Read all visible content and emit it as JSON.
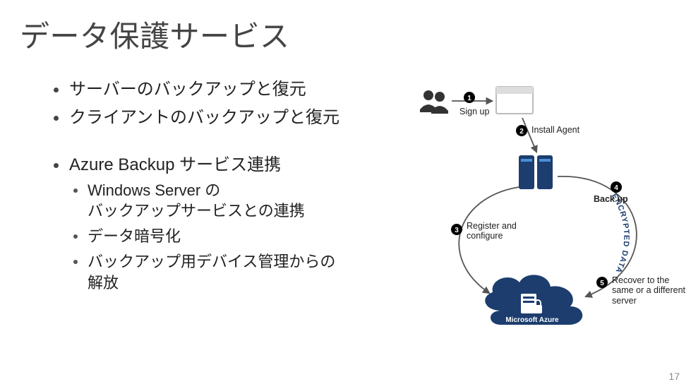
{
  "title": "データ保護サービス",
  "bullets": {
    "b1": "サーバーのバックアップと復元",
    "b2": "クライアントのバックアップと復元",
    "b3": "Azure Backup サービス連携",
    "b3s1": "Windows Server の\nバックアップサービスとの連携",
    "b3s2": "データ暗号化",
    "b3s3": "バックアップ用デバイス管理からの\n解放"
  },
  "diagram": {
    "step1": "Sign up",
    "step2": "Install Agent",
    "step3": "Register and\nconfigure",
    "step4": "Back up",
    "step5": "Recover to the\nsame or a different\nserver",
    "arc_text": "ENCRYPTED DATA",
    "cloud_label": "Microsoft Azure"
  },
  "colors": {
    "brand_navy": "#1c3d6e",
    "accent_blue": "#4a90d9",
    "text": "#333333"
  },
  "page_number": "17"
}
